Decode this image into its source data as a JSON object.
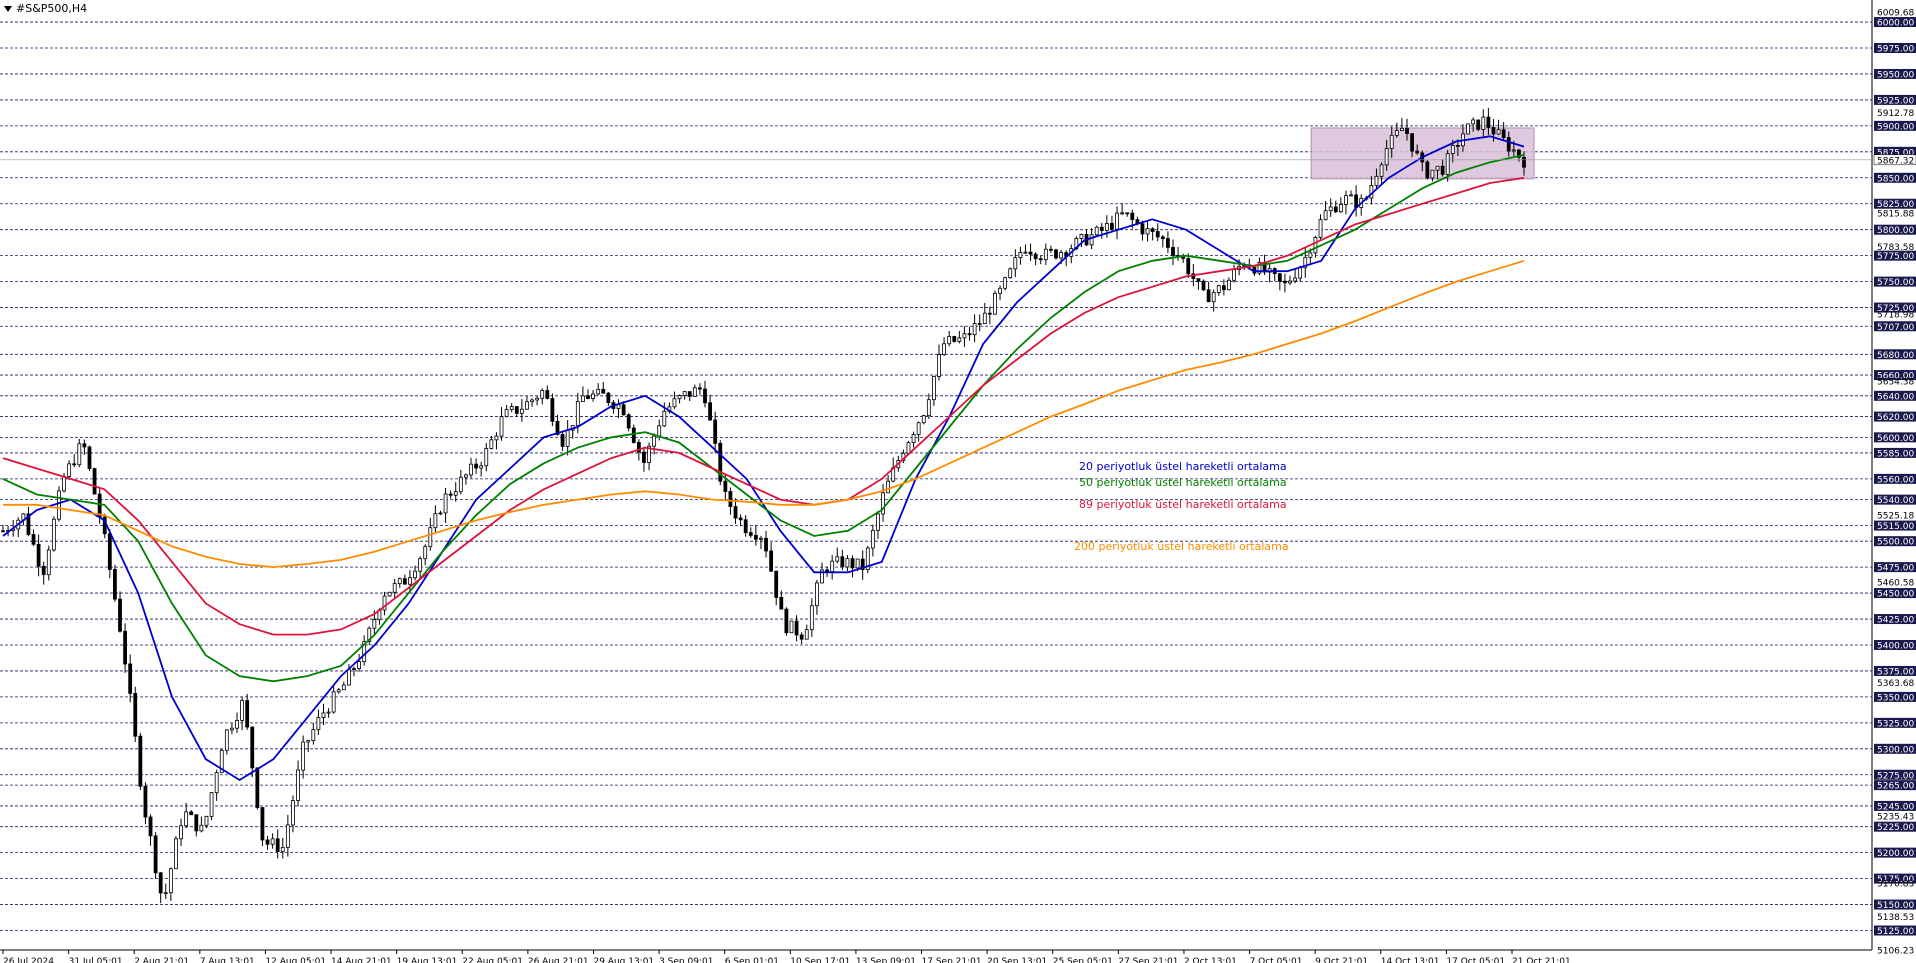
{
  "window": {
    "symbol_title": "#S&P500,H4"
  },
  "colors": {
    "background": "#ffffff",
    "grid": "#1a1a5e",
    "candle": "#000000",
    "ema20": "#0000cd",
    "ema50": "#008000",
    "ema89": "#dc143c",
    "ema200": "#ff8c00",
    "range_box": "#d8bfd8",
    "price_badge_bg": "#1a1a4e",
    "price_badge_text": "#ffffff"
  },
  "legend": [
    {
      "label": "20 periyotluk üstel hareketli ortalama",
      "color": "#0000cd"
    },
    {
      "label": "50 periyotluk üstel hareketli ortalama",
      "color": "#008000"
    },
    {
      "label": "89 periyotluk üstel hareketli ortalama",
      "color": "#dc143c"
    },
    {
      "label": "200 periyotluk üstel hareketli ortalama",
      "color": "#ff8c00"
    }
  ],
  "chart_data": {
    "type": "candlestick",
    "title": "#S&P500,H4",
    "ylim": [
      5106.23,
      6009.68
    ],
    "grid": true,
    "x_ticks": [
      "26 Jul 2024",
      "31 Jul 05:01",
      "2 Aug 21:01",
      "7 Aug 13:01",
      "12 Aug 05:01",
      "14 Aug 21:01",
      "19 Aug 13:01",
      "22 Aug 05:01",
      "26 Aug 21:01",
      "29 Aug 13:01",
      "3 Sep 09:01",
      "6 Sep 01:01",
      "10 Sep 17:01",
      "13 Sep 09:01",
      "17 Sep 21:01",
      "20 Sep 13:01",
      "25 Sep 05:01",
      "27 Sep 21:01",
      "2 Oct 13:01",
      "7 Oct 05:01",
      "9 Oct 21:01",
      "14 Oct 13:01",
      "17 Oct 05:01",
      "21 Oct 21:01"
    ],
    "y_badges": [
      "6000.00",
      "5975.00",
      "5950.00",
      "5925.00",
      "5900.00",
      "5875.00",
      "5850.00",
      "5825.00",
      "5800.00",
      "5775.00",
      "5750.00",
      "5725.00",
      "5707.00",
      "5680.00",
      "5660.00",
      "5640.00",
      "5620.00",
      "5600.00",
      "5585.00",
      "5560.00",
      "5540.00",
      "5515.00",
      "5500.00",
      "5475.00",
      "5450.00",
      "5425.00",
      "5400.00",
      "5375.00",
      "5350.00",
      "5325.00",
      "5300.00",
      "5275.00",
      "5265.00",
      "5245.00",
      "5225.00",
      "5200.00",
      "5175.00",
      "5150.00",
      "5125.00"
    ],
    "y_plain_labels": [
      "6009.68",
      "5912.78",
      "5815.88",
      "5783.58",
      "5718.98",
      "5654.38",
      "5525.18",
      "5460.58",
      "5363.68",
      "5235.43",
      "5170.83",
      "5138.53",
      "5106.23"
    ],
    "current_price": "5867.32",
    "range_box": {
      "price_high": 5898,
      "price_low": 5849,
      "from": "9 Oct 21:01",
      "to": "21 Oct 21:01"
    },
    "price_path": [
      [
        "26 Jul 2024",
        5510
      ],
      [
        "29 Jul",
        5525
      ],
      [
        "30 Jul",
        5470
      ],
      [
        "31 Jul 05:01",
        5560
      ],
      [
        "31 Jul 21:00",
        5595
      ],
      [
        "1 Aug",
        5510
      ],
      [
        "2 Aug 05:00",
        5400
      ],
      [
        "2 Aug 21:01",
        5250
      ],
      [
        "5 Aug",
        5150
      ],
      [
        "5 Aug 13:00",
        5240
      ],
      [
        "6 Aug",
        5220
      ],
      [
        "6 Aug 13:00",
        5310
      ],
      [
        "7 Aug 05:00",
        5345
      ],
      [
        "7 Aug 13:01",
        5210
      ],
      [
        "8 Aug",
        5205
      ],
      [
        "8 Aug 13:00",
        5300
      ],
      [
        "9 Aug",
        5335
      ],
      [
        "12 Aug 05:01",
        5360
      ],
      [
        "12 Aug 13:00",
        5395
      ],
      [
        "13 Aug",
        5450
      ],
      [
        "14 Aug",
        5460
      ],
      [
        "14 Aug 21:01",
        5490
      ],
      [
        "15 Aug",
        5540
      ],
      [
        "16 Aug",
        5560
      ],
      [
        "19 Aug 13:01",
        5580
      ],
      [
        "20 Aug",
        5620
      ],
      [
        "21 Aug",
        5630
      ],
      [
        "22 Aug 05:01",
        5645
      ],
      [
        "22 Aug 13:00",
        5595
      ],
      [
        "23 Aug",
        5640
      ],
      [
        "26 Aug 21:01",
        5640
      ],
      [
        "27 Aug",
        5628
      ],
      [
        "28 Aug",
        5575
      ],
      [
        "29 Aug 13:01",
        5625
      ],
      [
        "30 Aug",
        5640
      ],
      [
        "2 Sep",
        5648
      ],
      [
        "3 Sep 09:01",
        5545
      ],
      [
        "4 Sep",
        5515
      ],
      [
        "5 Sep",
        5505
      ],
      [
        "6 Sep 01:01",
        5420
      ],
      [
        "6 Sep 13:00",
        5410
      ],
      [
        "9 Sep",
        5475
      ],
      [
        "10 Sep",
        5480
      ],
      [
        "10 Sep 17:01",
        5475
      ],
      [
        "11 Sep",
        5545
      ],
      [
        "12 Sep",
        5590
      ],
      [
        "13 Sep 09:01",
        5625
      ],
      [
        "13 Sep 21:00",
        5690
      ],
      [
        "16 Sep",
        5695
      ],
      [
        "17 Sep 21:01",
        5715
      ],
      [
        "18 Sep",
        5745
      ],
      [
        "19 Sep",
        5785
      ],
      [
        "20 Sep 13:01",
        5775
      ],
      [
        "23 Sep",
        5780
      ],
      [
        "24 Sep",
        5790
      ],
      [
        "25 Sep 05:01",
        5800
      ],
      [
        "26 Sep",
        5815
      ],
      [
        "27 Sep 21:01",
        5800
      ],
      [
        "30 Sep",
        5790
      ],
      [
        "1 Oct",
        5770
      ],
      [
        "2 Oct 13:01",
        5735
      ],
      [
        "3 Oct",
        5745
      ],
      [
        "4 Oct",
        5770
      ],
      [
        "7 Oct 05:01",
        5760
      ],
      [
        "7 Oct 21:00",
        5745
      ],
      [
        "8 Oct",
        5770
      ],
      [
        "9 Oct 21:01",
        5815
      ],
      [
        "10 Oct",
        5830
      ],
      [
        "11 Oct",
        5825
      ],
      [
        "14 Oct 13:01",
        5875
      ],
      [
        "14 Oct 21:00",
        5900
      ],
      [
        "15 Oct",
        5855
      ],
      [
        "16 Oct",
        5860
      ],
      [
        "17 Oct 05:01",
        5895
      ],
      [
        "18 Oct",
        5905
      ],
      [
        "21 Oct",
        5885
      ],
      [
        "21 Oct 21:01",
        5867
      ]
    ],
    "series": [
      {
        "name": "20 periyotluk üstel hareketli ortalama",
        "values": [
          5505,
          5530,
          5540,
          5520,
          5450,
          5350,
          5290,
          5270,
          5290,
          5330,
          5370,
          5400,
          5440,
          5490,
          5540,
          5570,
          5600,
          5610,
          5630,
          5640,
          5620,
          5590,
          5560,
          5510,
          5470,
          5470,
          5480,
          5560,
          5620,
          5690,
          5730,
          5760,
          5790,
          5800,
          5810,
          5800,
          5780,
          5760,
          5760,
          5770,
          5820,
          5850,
          5870,
          5885,
          5890,
          5880
        ]
      },
      {
        "name": "50 periyotluk üstel hareketli ortalama",
        "values": [
          5560,
          5545,
          5540,
          5535,
          5500,
          5440,
          5390,
          5370,
          5365,
          5370,
          5380,
          5410,
          5450,
          5490,
          5525,
          5555,
          5575,
          5590,
          5600,
          5605,
          5595,
          5570,
          5545,
          5520,
          5505,
          5510,
          5530,
          5570,
          5610,
          5650,
          5685,
          5715,
          5740,
          5760,
          5770,
          5775,
          5770,
          5765,
          5770,
          5785,
          5800,
          5820,
          5840,
          5855,
          5865,
          5872
        ]
      },
      {
        "name": "89 periyotluk üstel hareketli ortalama",
        "values": [
          5580,
          5570,
          5560,
          5550,
          5520,
          5480,
          5440,
          5420,
          5410,
          5410,
          5415,
          5430,
          5455,
          5480,
          5505,
          5530,
          5550,
          5565,
          5580,
          5590,
          5585,
          5570,
          5555,
          5540,
          5535,
          5540,
          5560,
          5590,
          5620,
          5650,
          5675,
          5700,
          5720,
          5735,
          5745,
          5755,
          5760,
          5765,
          5775,
          5790,
          5805,
          5815,
          5825,
          5835,
          5845,
          5850
        ]
      },
      {
        "name": "200 periyotluk üstel hareketli ortalama",
        "values": [
          5535,
          5535,
          5530,
          5525,
          5510,
          5495,
          5485,
          5478,
          5475,
          5478,
          5482,
          5490,
          5500,
          5510,
          5520,
          5528,
          5535,
          5540,
          5545,
          5548,
          5545,
          5540,
          5538,
          5535,
          5535,
          5540,
          5548,
          5560,
          5575,
          5590,
          5605,
          5620,
          5632,
          5645,
          5655,
          5665,
          5672,
          5680,
          5690,
          5700,
          5712,
          5725,
          5738,
          5750,
          5760,
          5770
        ]
      }
    ]
  }
}
